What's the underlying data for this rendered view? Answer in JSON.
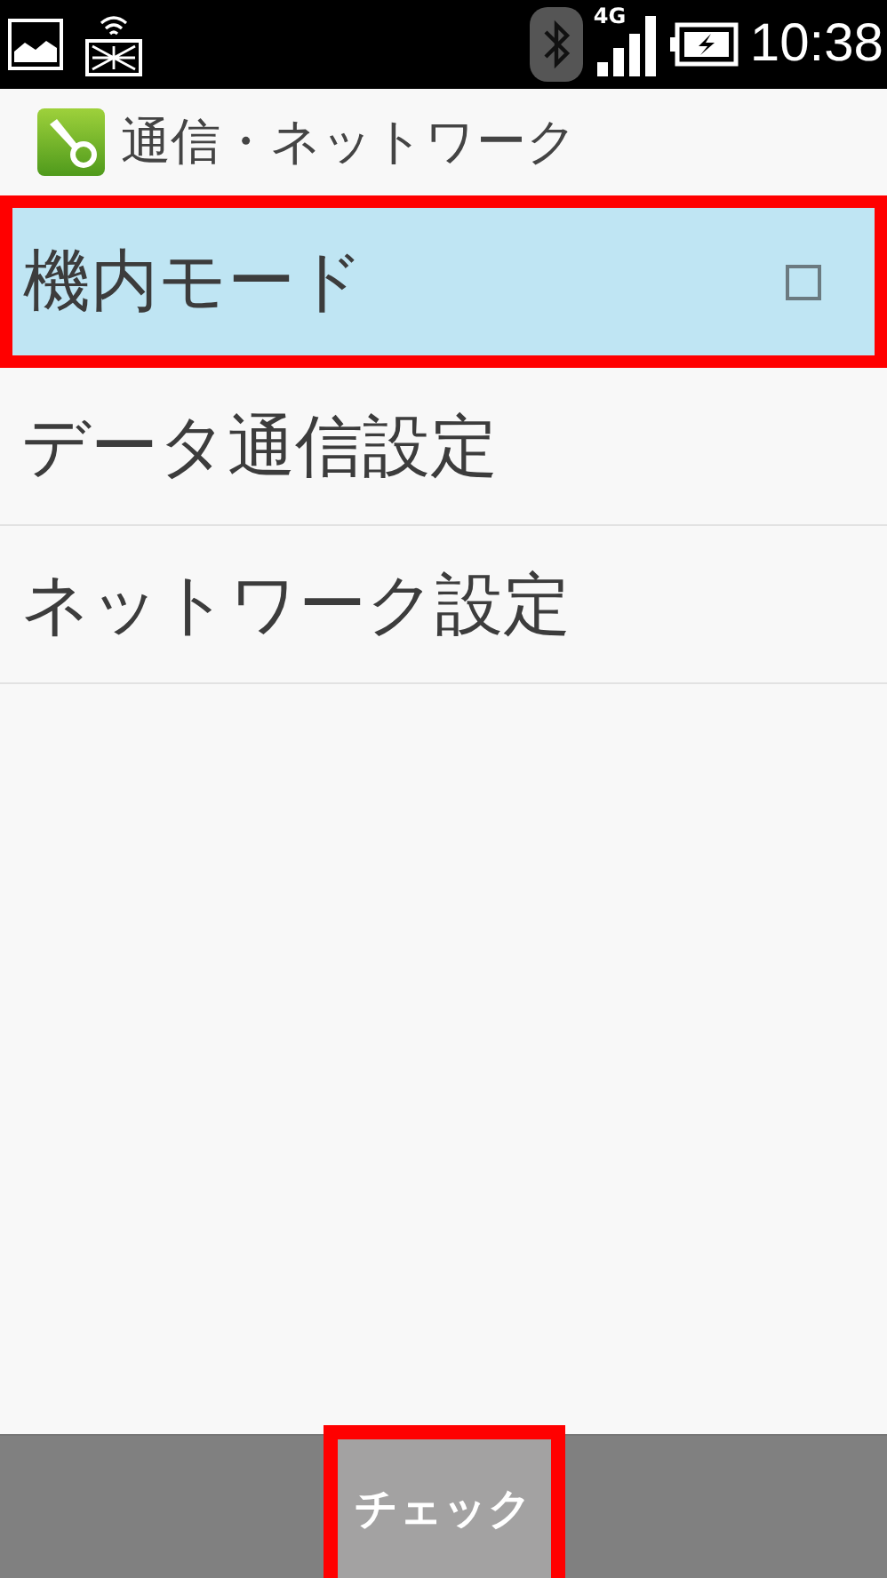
{
  "status_bar": {
    "time": "10:38",
    "network": "4G"
  },
  "header": {
    "title": "通信・ネットワーク"
  },
  "items": [
    {
      "kind": "checkbox",
      "label": "機内モード",
      "selected": true,
      "checked": false,
      "highlighted": true
    },
    {
      "kind": "link",
      "label": "データ通信設定",
      "selected": false,
      "highlighted": false
    },
    {
      "kind": "link",
      "label": "ネットワーク設定",
      "selected": false,
      "highlighted": false
    }
  ],
  "bottom_bar": {
    "button": {
      "label": "チェック",
      "highlighted": true
    }
  }
}
